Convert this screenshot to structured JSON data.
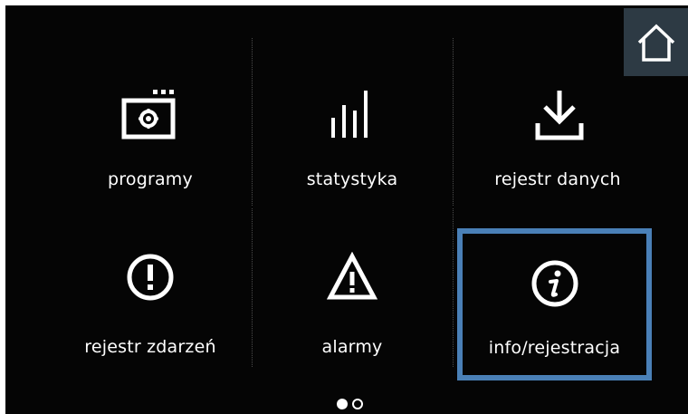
{
  "home": {
    "icon": "home-icon"
  },
  "menu": {
    "items": [
      {
        "label": "programy",
        "icon": "program-icon"
      },
      {
        "label": "statystyka",
        "icon": "bar-chart-icon"
      },
      {
        "label": "rejestr danych",
        "icon": "download-icon"
      },
      {
        "label": "rejestr zdarzeń",
        "icon": "exclamation-circle-icon"
      },
      {
        "label": "alarmy",
        "icon": "warning-triangle-icon"
      },
      {
        "label": "info/rejestracja",
        "icon": "info-icon",
        "selected": true
      }
    ]
  },
  "pagination": {
    "current_page": 1,
    "total_pages": 2
  },
  "colors": {
    "background": "#050505",
    "home_button": "#2d3a44",
    "selection_border": "#4a80b7",
    "text": "#ffffff"
  }
}
